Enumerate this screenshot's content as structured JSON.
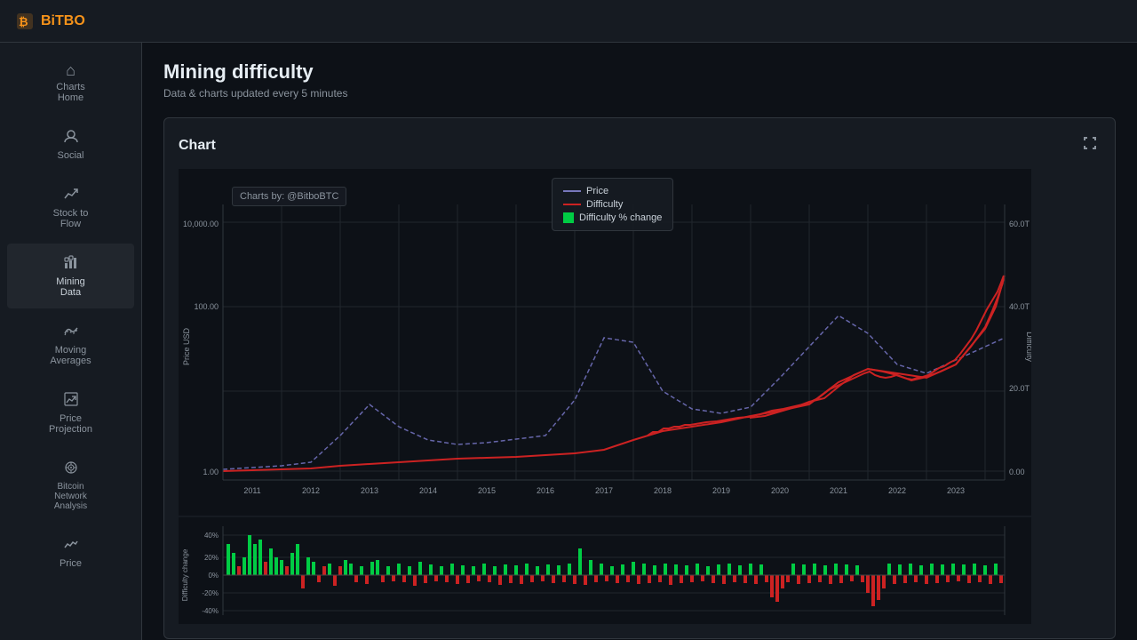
{
  "app": {
    "logo": "BiTBO",
    "logo_icon": "₿"
  },
  "topbar": {
    "title": "BiTBO"
  },
  "sidebar": {
    "items": [
      {
        "id": "charts-home",
        "label": "Charts\nHome",
        "icon": "⌂"
      },
      {
        "id": "social",
        "label": "Social",
        "icon": "🔔"
      },
      {
        "id": "stock-to-flow",
        "label": "Stock to\nFlow",
        "icon": "📈"
      },
      {
        "id": "mining-data",
        "label": "Mining\nData",
        "icon": "⚙"
      },
      {
        "id": "moving-averages",
        "label": "Moving\nAverages",
        "icon": "〜"
      },
      {
        "id": "price-projection",
        "label": "Price\nProjection",
        "icon": "📊"
      },
      {
        "id": "bitcoin-network-analysis",
        "label": "Bitcoin\nNetwork\nAnalysis",
        "icon": "◎"
      },
      {
        "id": "price",
        "label": "Price",
        "icon": "~"
      }
    ]
  },
  "page": {
    "title": "Mining difficulty",
    "subtitle": "Data & charts updated every 5 minutes"
  },
  "chart": {
    "title": "Chart",
    "attribution": "Charts by: @BitboBTC",
    "fullscreen_label": "⛶",
    "legend": {
      "items": [
        {
          "label": "Price",
          "type": "dashed-line",
          "color": "#8888cc"
        },
        {
          "label": "Difficulty",
          "type": "solid-line",
          "color": "#cc2222"
        },
        {
          "label": "Difficulty % change",
          "type": "square",
          "color": "#00cc44"
        }
      ]
    },
    "main": {
      "y_left_labels": [
        "10,000.00",
        "100.00",
        "1.00"
      ],
      "y_right_labels": [
        "60.0T",
        "40.0T",
        "20.0T",
        "0.00"
      ],
      "x_labels": [
        "2011",
        "2012",
        "2013",
        "2014",
        "2015",
        "2016",
        "2017",
        "2018",
        "2019",
        "2020",
        "2021",
        "2022",
        "2023"
      ],
      "y_left_axis_label": "Price USD",
      "y_right_axis_label": "Difficulty"
    },
    "bottom": {
      "y_labels": [
        "40%",
        "20%",
        "0%",
        "-20%",
        "-40%"
      ],
      "y_axis_label": "Difficulty change"
    }
  }
}
